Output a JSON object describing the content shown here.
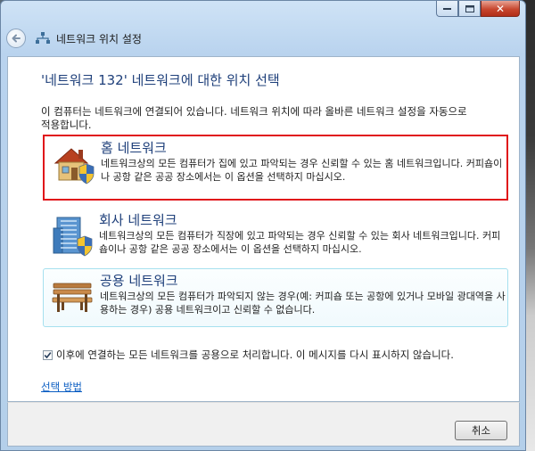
{
  "window": {
    "title": "네트워크 위치 설정",
    "caption_buttons": [
      "minimize",
      "maximize",
      "close"
    ],
    "close_glyph": "✕"
  },
  "main": {
    "heading": "'네트워크  132' 네트워크에 대한 위치 선택",
    "description": "이 컴퓨터는 네트워크에 연결되어 있습니다. 네트워크 위치에 따라 올바른 네트워크 설정을 자동으로 적용합니다.",
    "options": [
      {
        "title": "홈 네트워크",
        "description": "네트워크상의 모든 컴퓨터가 집에 있고 파악되는 경우 신뢰할 수 있는 홈 네트워크입니다. 커피숍이나 공항 같은 공공 장소에서는 이 옵션을 선택하지 마십시오.",
        "icon": "house-icon",
        "highlighted": true
      },
      {
        "title": "회사 네트워크",
        "description": "네트워크상의 모든 컴퓨터가 직장에 있고 파악되는 경우 신뢰할 수 있는 회사 네트워크입니다. 커피숍이나 공항 같은 공공 장소에서는 이 옵션을 선택하지 마십시오.",
        "icon": "office-building-icon"
      },
      {
        "title": "공용 네트워크",
        "description": "네트워크상의 모든 컴퓨터가 파악되지 않는 경우(예: 커피숍 또는 공항에 있거나 모바일 광대역을 사용하는 경우) 공용 네트워크이고 신뢰할 수 없습니다.",
        "icon": "park-bench-icon",
        "hovered": true
      }
    ],
    "checkbox": {
      "label": "이후에 연결하는 모든 네트워크를 공용으로 처리합니다. 이 메시지를 다시 표시하지 않습니다.",
      "checked": true
    },
    "help_link": "선택 방법"
  },
  "footer": {
    "cancel_label": "취소"
  },
  "colors": {
    "heading_blue": "#1e3f7a",
    "highlight_red": "#e0141a",
    "link_blue": "#0a5dc2",
    "close_red": "#c7472f"
  }
}
